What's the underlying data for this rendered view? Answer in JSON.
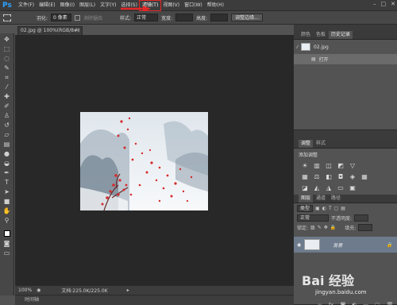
{
  "app": {
    "logo": "Ps"
  },
  "menu": [
    {
      "label": "文件(F)"
    },
    {
      "label": "编辑(E)"
    },
    {
      "label": "图像(I)"
    },
    {
      "label": "图层(L)"
    },
    {
      "label": "文字(Y)"
    },
    {
      "label": "选择(S)"
    },
    {
      "label": "滤镜(T)",
      "active": true
    },
    {
      "label": "视图(V)"
    },
    {
      "label": "窗口(W)"
    },
    {
      "label": "帮助(H)"
    }
  ],
  "window_controls": [
    "–",
    "□",
    "✕"
  ],
  "options": {
    "feather_label": "羽化:",
    "feather_value": "0 像素",
    "antialias_label": "消除锯齿",
    "style_label": "样式:",
    "style_value": "正常",
    "width_label": "宽度:",
    "height_label": "高度:",
    "refine_button": "调整边缘..."
  },
  "document": {
    "tab": "02.jpg @ 100%(RGB/8#)",
    "close": "×"
  },
  "status": {
    "zoom": "100%",
    "doc_size": "文档:225.0K/225.0K"
  },
  "timeline": {
    "label": "时间轴"
  },
  "history_panel": {
    "tabs": [
      "颜色",
      "色板",
      "历史记录"
    ],
    "snapshot": "02.jpg",
    "step": "打开"
  },
  "adjust_panel": {
    "tabs": [
      "调整",
      "样式"
    ],
    "title": "添加调整"
  },
  "layers_panel": {
    "tabs": [
      "图层",
      "通道",
      "路径"
    ],
    "kind": "类型",
    "blend": "正常",
    "opacity_label": "不透明度:",
    "lock_label": "锁定:",
    "fill_label": "填充:",
    "layer_name": "背景"
  },
  "watermark": {
    "main": "Bai 经验",
    "sub": "jingyan.baidu.com"
  },
  "colors": {
    "accent": "#2fa3ff",
    "highlight": "#e02828",
    "petal": "#d42a2a"
  }
}
